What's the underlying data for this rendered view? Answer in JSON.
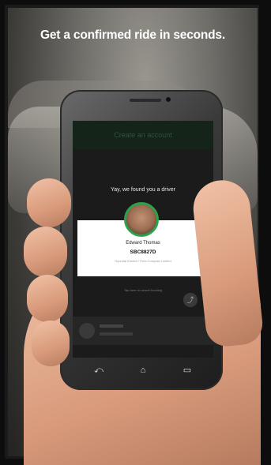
{
  "headline": "Get a confirmed ride in seconds.",
  "phone": {
    "screen": {
      "topbar_text": "Create an account",
      "status_text": "Yay, we found you a driver",
      "driver": {
        "name": "Edward Thomas",
        "plate": "SBC8827D",
        "vehicle_line": "Hyundai Elantra / Flexi Compact Limited"
      },
      "footer_note": "Tap here to cancel booking",
      "share_icon": "share-icon",
      "nav_icons": [
        "back-icon",
        "home-icon",
        "recent-apps-icon"
      ]
    }
  },
  "colors": {
    "accent_green": "#2aa34a",
    "topbar_green": "#142419"
  }
}
